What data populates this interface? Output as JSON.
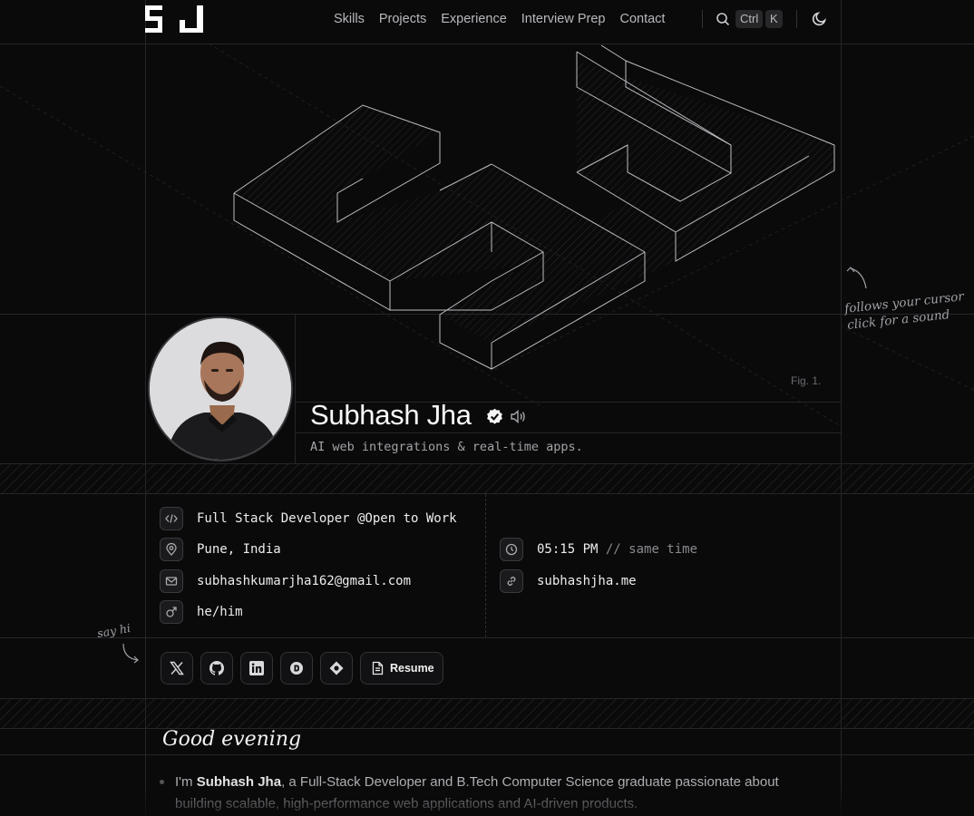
{
  "nav": {
    "items": [
      "Skills",
      "Projects",
      "Experience",
      "Interview Prep",
      "Contact"
    ],
    "search_key_1": "Ctrl",
    "search_key_2": "K"
  },
  "hero": {
    "figure_caption": "Fig. 1.",
    "hint_line_1": "follows your cursor",
    "hint_line_2": "click for a sound"
  },
  "profile": {
    "name": "Subhash Jha",
    "tagline": "AI web integrations & real-time apps.",
    "verified_icon": "verified-badge-icon",
    "sound_icon": "speaker-icon"
  },
  "info": {
    "role": "Full Stack Developer @Open to Work",
    "location": "Pune, India",
    "email": "subhashkumarjha162@gmail.com",
    "pronouns": "he/him",
    "time": "05:15 PM",
    "time_note": "// same time",
    "website": "subhashjha.me"
  },
  "socials": {
    "say_hi": "say hi",
    "icons": [
      "x-icon",
      "github-icon",
      "linkedin-icon",
      "daily-dev-icon",
      "portfolio-icon"
    ],
    "resume_label": "Resume"
  },
  "about": {
    "greeting": "Good evening",
    "intro_prefix": "I'm ",
    "intro_name": "Subhash Jha",
    "intro_rest": ", a Full-Stack Developer and B.Tech Computer Science graduate passionate about building scalable, high-performance web applications and AI-driven products."
  },
  "colors": {
    "background": "#0a0a0b",
    "line": "#262629",
    "text": "#e5e5e5"
  }
}
